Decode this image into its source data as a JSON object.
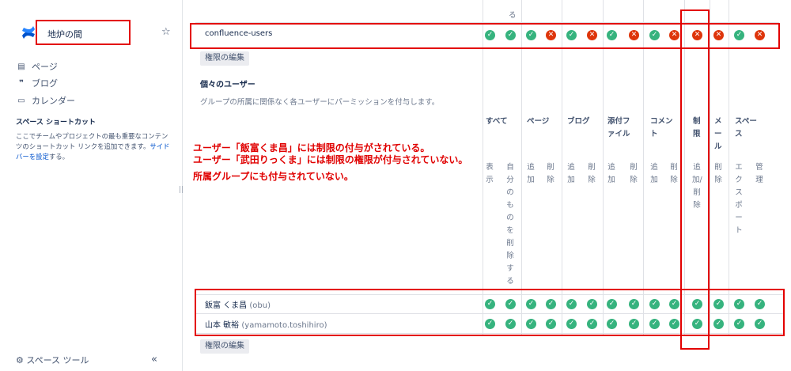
{
  "sidebar": {
    "space_name": "地炉の間",
    "nav": [
      {
        "icon": "page-icon",
        "label": "ページ"
      },
      {
        "icon": "blog-icon",
        "label": "ブログ"
      },
      {
        "icon": "calendar-icon",
        "label": "カレンダー"
      }
    ],
    "shortcut_heading": "スペース ショートカット",
    "shortcut_desc": "ここでチームやプロジェクトの最も重要なコンテンツのショートカット リンクを追加できます。",
    "shortcut_link": "サイドバーを設定",
    "shortcut_tail": "する。",
    "tools_label": "スペース ツール",
    "collapse_label": "«"
  },
  "permissions": {
    "group_row": {
      "name": "confluence-users",
      "values": [
        true,
        true,
        true,
        false,
        true,
        false,
        true,
        false,
        true,
        false,
        false,
        false,
        true,
        false
      ]
    },
    "edit_button": "権限の編集",
    "individual_title": "個々のユーザー",
    "individual_desc": "グループの所属に関係なく各ユーザーにパーミッションを付与します。",
    "top_fragment": "る",
    "groups": [
      {
        "label": "すべて"
      },
      {
        "label": "ページ"
      },
      {
        "label": "ブログ"
      },
      {
        "label": "添付フ\nァイル"
      },
      {
        "label": "コメン\nト"
      },
      {
        "label": "制\n限"
      },
      {
        "label": "メ\nー\nル"
      },
      {
        "label": "スペー\nス"
      }
    ],
    "columns": [
      "表\n示",
      "自\n分\nの\nも\nの\nを\n削\n除\nす\nる",
      "追\n加",
      "削\n除",
      "追\n加",
      "削\n除",
      "追\n加",
      "削\n除",
      "追\n加",
      "削\n除",
      "追\n加/\n削\n除",
      "削\n除",
      "エ\nク\nス\nポ\nー\nト",
      "管\n理"
    ],
    "users": [
      {
        "name": "飯富 くま昌",
        "id": "(obu)",
        "values": [
          true,
          true,
          true,
          true,
          true,
          true,
          true,
          true,
          true,
          true,
          true,
          true,
          true,
          true
        ]
      },
      {
        "name": "山本 敏裕",
        "id": "(yamamoto.toshihiro)",
        "values": [
          true,
          true,
          true,
          true,
          true,
          true,
          true,
          true,
          true,
          true,
          true,
          true,
          true,
          true
        ]
      }
    ]
  },
  "notes": {
    "line1": "ユーザー「飯富くま昌」には制限の付与がされている。",
    "line2": "ユーザー「武田りっくま」には制限の権限が付与されていない。",
    "line3": "所属グループにも付与されていない。"
  },
  "colors": {
    "allowed": "#36b37e",
    "denied": "#de350b",
    "annotation": "#e30000",
    "link": "#0052cc"
  }
}
